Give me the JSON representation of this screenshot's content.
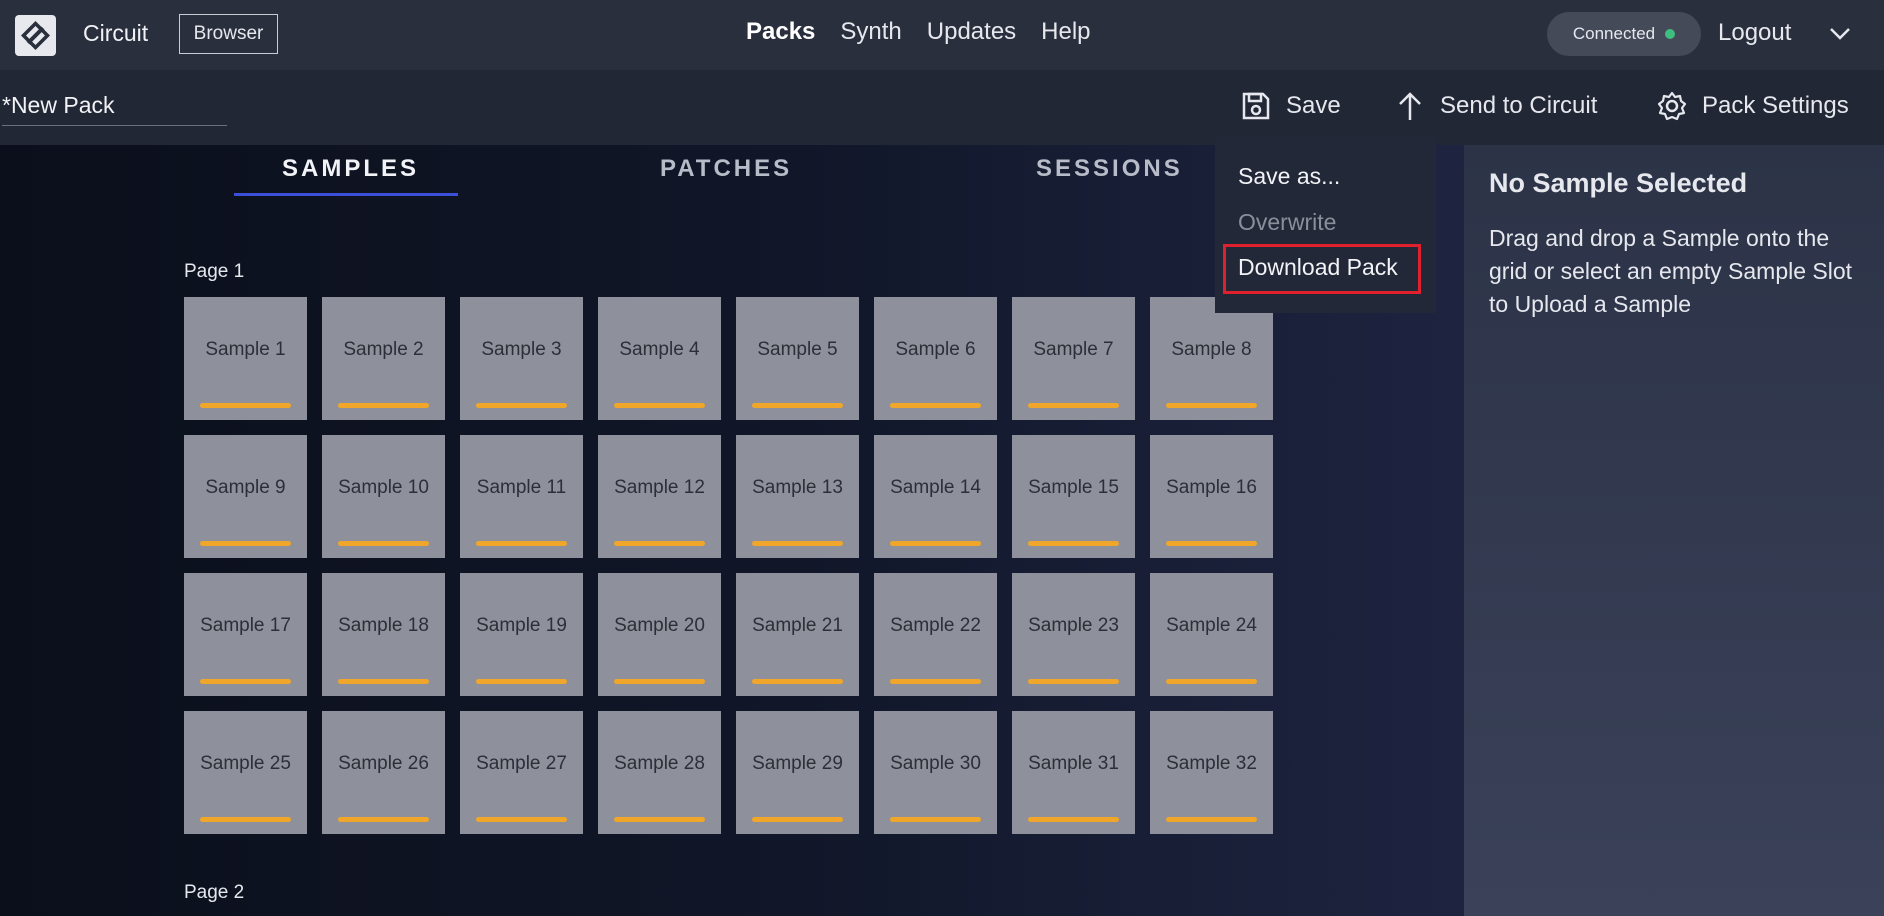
{
  "header": {
    "app_name": "Circuit",
    "browser_label": "Browser",
    "nav": [
      "Packs",
      "Synth",
      "Updates",
      "Help"
    ],
    "active_nav": "Packs",
    "status": "Connected",
    "logout_label": "Logout"
  },
  "toolbar": {
    "pack_name": "*New Pack",
    "save_label": "Save",
    "send_label": "Send to Circuit",
    "settings_label": "Pack Settings"
  },
  "save_menu": {
    "items": [
      {
        "label": "Save as...",
        "disabled": false
      },
      {
        "label": "Overwrite",
        "disabled": true
      },
      {
        "label": "Download Pack",
        "disabled": false,
        "highlighted": true
      }
    ]
  },
  "tabs": [
    "SAMPLES",
    "PATCHES",
    "SESSIONS"
  ],
  "active_tab": "SAMPLES",
  "pages": [
    {
      "label": "Page 1",
      "samples": [
        "Sample 1",
        "Sample 2",
        "Sample 3",
        "Sample 4",
        "Sample 5",
        "Sample 6",
        "Sample 7",
        "Sample 8",
        "Sample 9",
        "Sample 10",
        "Sample 11",
        "Sample 12",
        "Sample 13",
        "Sample 14",
        "Sample 15",
        "Sample 16",
        "Sample 17",
        "Sample 18",
        "Sample 19",
        "Sample 20",
        "Sample 21",
        "Sample 22",
        "Sample 23",
        "Sample 24",
        "Sample 25",
        "Sample 26",
        "Sample 27",
        "Sample 28",
        "Sample 29",
        "Sample 30",
        "Sample 31",
        "Sample 32"
      ]
    },
    {
      "label": "Page 2",
      "samples": []
    }
  ],
  "side_panel": {
    "title": "No Sample Selected",
    "text": "Drag and drop a Sample onto the grid or select an empty Sample Slot to Upload a Sample"
  },
  "colors": {
    "accent": "#3b4fd8",
    "sample_bar": "#f0a62a",
    "connected": "#3fbf7f",
    "highlight": "#e0202c"
  }
}
